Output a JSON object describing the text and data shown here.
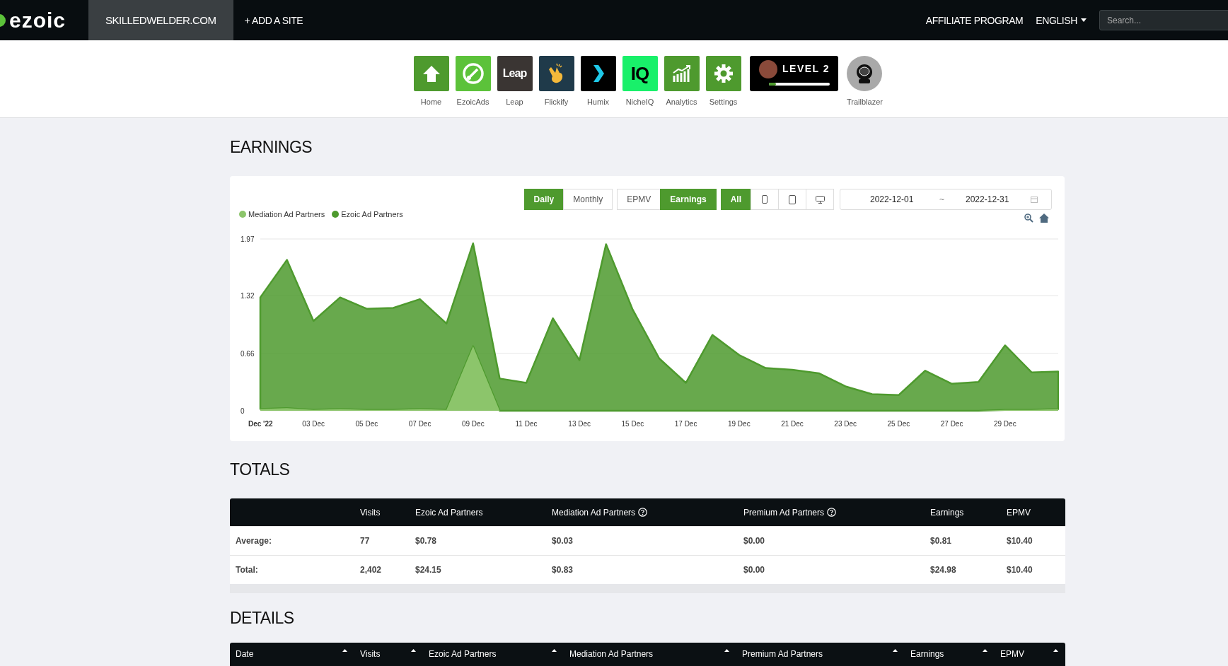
{
  "topbar": {
    "logo": "ezoic",
    "site": "SKILLEDWELDER.COM",
    "add_site": "+ ADD A SITE",
    "affiliate": "AFFILIATE PROGRAM",
    "language": "ENGLISH",
    "search": {
      "placeholder": "Search..."
    }
  },
  "apps": [
    {
      "label": "Home",
      "kind": "home",
      "color": "#4e9a2e"
    },
    {
      "label": "EzoicAds",
      "kind": "gauge",
      "color": "#5cc23a"
    },
    {
      "label": "Leap",
      "kind": "wordmark",
      "logo_text": "Leap",
      "color": "#3a3533"
    },
    {
      "label": "Flickify",
      "kind": "hand",
      "color": "#1f3a4a"
    },
    {
      "label": "Humix",
      "kind": "chevron",
      "color": "#000000"
    },
    {
      "label": "NicheIQ",
      "kind": "wordmark",
      "logo_text": "IQ",
      "color": "#19f06a"
    },
    {
      "label": "Analytics",
      "kind": "chart",
      "color": "#4e9a2e"
    },
    {
      "label": "Settings",
      "kind": "gear",
      "color": "#4e9a2e"
    }
  ],
  "level_card": {
    "text": "LEVEL 2",
    "level": 0.12
  },
  "trailblazer": {
    "label": "Trailblazer"
  },
  "earnings": {
    "heading": "EARNINGS",
    "period_buttons": [
      {
        "label": "Daily",
        "selected": true
      },
      {
        "label": "Monthly",
        "selected": false
      }
    ],
    "metric_buttons": [
      {
        "label": "EPMV",
        "selected": false
      },
      {
        "label": "Earnings",
        "selected": true
      }
    ],
    "device_buttons": [
      {
        "kind": "all",
        "label": "All",
        "selected": true
      },
      {
        "kind": "phone",
        "selected": false
      },
      {
        "kind": "tablet",
        "selected": false
      },
      {
        "kind": "desktop",
        "selected": false
      }
    ],
    "date_range": {
      "start": "2022-12-01",
      "separator": "~",
      "end": "2022-12-31"
    },
    "chart_data": {
      "type": "area",
      "stacked": true,
      "categories": [
        "Dec '22",
        null,
        "03 Dec",
        null,
        "05 Dec",
        null,
        "07 Dec",
        null,
        "09 Dec",
        null,
        "11 Dec",
        null,
        "13 Dec",
        null,
        "15 Dec",
        null,
        "17 Dec",
        null,
        "19 Dec",
        null,
        "21 Dec",
        null,
        "23 Dec",
        null,
        "25 Dec",
        null,
        "27 Dec",
        null,
        "29 Dec",
        null,
        null
      ],
      "ylim": [
        0,
        1.97
      ],
      "yticks": [
        0,
        0.66,
        1.32,
        1.97
      ],
      "series": [
        {
          "name": "Mediation Ad Partners",
          "color": "#8cc56b",
          "values": [
            0.02,
            0.03,
            0.01,
            0.02,
            0.01,
            0.01,
            0.02,
            0.01,
            0.74,
            0,
            0,
            0,
            0,
            0,
            0,
            0,
            0,
            0,
            0,
            0,
            0,
            0,
            0,
            0,
            0,
            0,
            0,
            0,
            0.01,
            0.01,
            0.02
          ]
        },
        {
          "name": "Ezoic Ad Partners",
          "color": "#4e9a2e",
          "values": [
            1.28,
            1.7,
            1.02,
            1.28,
            1.16,
            1.17,
            1.26,
            0.99,
            1.18,
            0.37,
            0.32,
            1.06,
            0.58,
            1.91,
            1.16,
            0.6,
            0.32,
            0.87,
            0.64,
            0.49,
            0.47,
            0.43,
            0.28,
            0.19,
            0.18,
            0.46,
            0.31,
            0.33,
            0.74,
            0.43,
            0.43
          ]
        }
      ]
    }
  },
  "totals": {
    "heading": "TOTALS",
    "columns": [
      {
        "label": "Visits",
        "help": false
      },
      {
        "label": "Ezoic Ad Partners",
        "help": false
      },
      {
        "label": "Mediation Ad Partners",
        "help": true
      },
      {
        "label": "Premium Ad Partners",
        "help": true
      },
      {
        "label": "Earnings",
        "help": false
      },
      {
        "label": "EPMV",
        "help": false
      }
    ],
    "rows": [
      {
        "label": "Average:",
        "cells": [
          "77",
          "$0.78",
          "$0.03",
          "$0.00",
          "$0.81",
          "$10.40"
        ]
      },
      {
        "label": "Total:",
        "cells": [
          "2,402",
          "$24.15",
          "$0.83",
          "$0.00",
          "$24.98",
          "$10.40"
        ]
      }
    ]
  },
  "details": {
    "heading": "DETAILS",
    "columns": [
      "Date",
      "Visits",
      "Ezoic Ad Partners",
      "Mediation Ad Partners",
      "Premium Ad Partners",
      "Earnings",
      "EPMV"
    ]
  }
}
